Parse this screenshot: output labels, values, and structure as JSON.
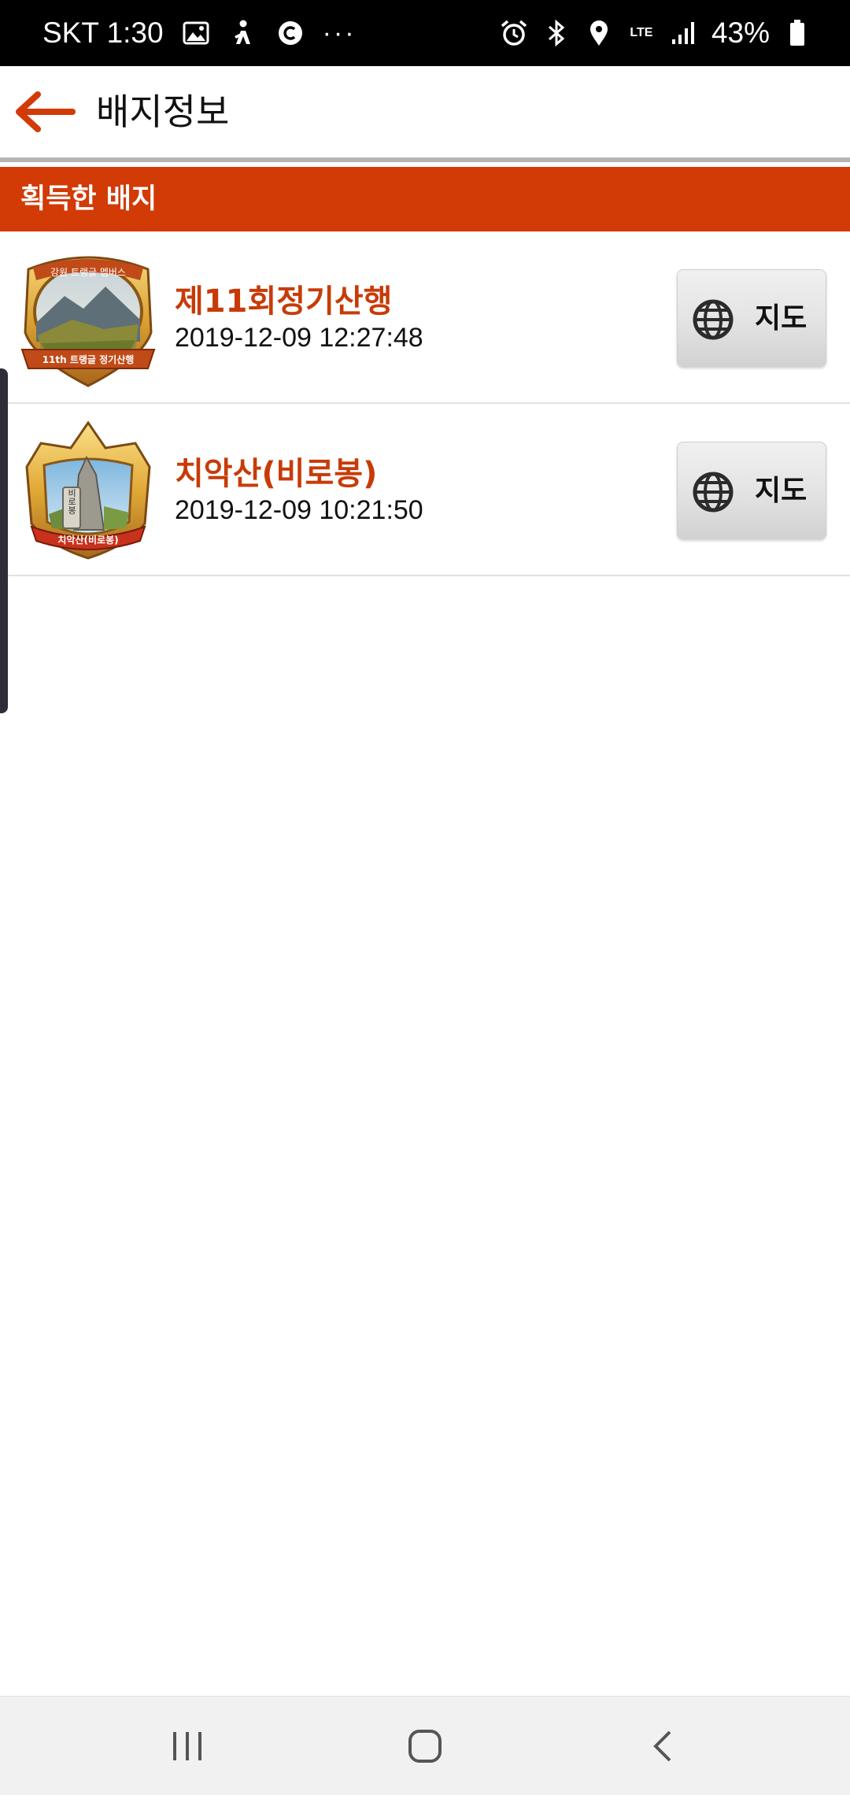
{
  "status_bar": {
    "carrier_time": "SKT 1:30",
    "more": "···",
    "network": "LTE",
    "battery": "43%"
  },
  "app_bar": {
    "title": "배지정보"
  },
  "section": {
    "title": "획득한 배지"
  },
  "badges": [
    {
      "title": "제11회정기산행",
      "date": "2019-12-09 12:27:48",
      "map_label": "지도",
      "badge_top_text": "강원 트랭글 멤버스",
      "badge_bottom_text": "11th 트랭글 정기산행"
    },
    {
      "title": "치악산(비로봉)",
      "date": "2019-12-09 10:21:50",
      "map_label": "지도",
      "badge_stone_text": "비로봉",
      "badge_bottom_text": "치악산(비로봉)"
    }
  ],
  "colors": {
    "accent": "#d23a06",
    "badge_title": "#c73b08",
    "status_bar": "#000000"
  }
}
